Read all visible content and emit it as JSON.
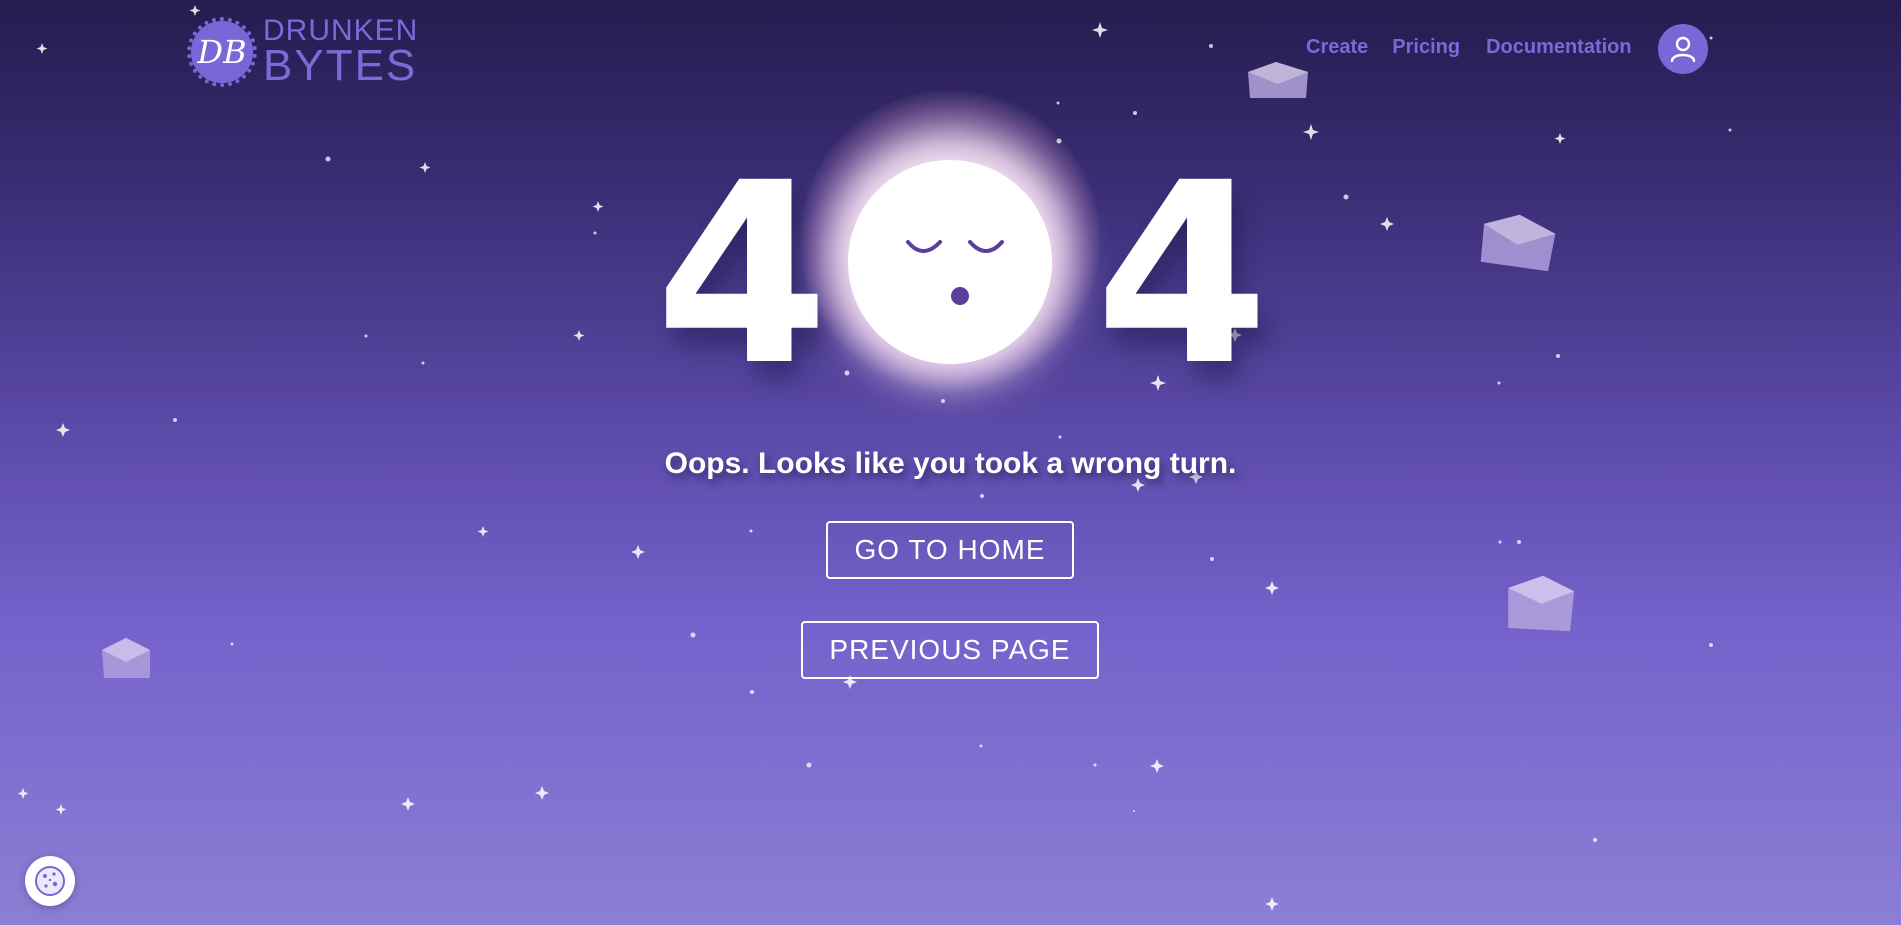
{
  "header": {
    "logo_monogram": "DB",
    "logo_line1": "DRUNKEN",
    "logo_line2": "BYTES",
    "nav": {
      "create": "Create",
      "pricing": "Pricing",
      "documentation": "Documentation"
    },
    "user_icon": "user-icon"
  },
  "error": {
    "digit_left": "4",
    "digit_right": "4",
    "moon_icon": "sleeping-moon-icon",
    "headline": "Oops. Looks like you took a wrong turn."
  },
  "buttons": {
    "home": "GO TO HOME",
    "previous": "PREVIOUS PAGE"
  },
  "cookie_icon": "cookie-icon",
  "colors": {
    "accent": "#7a66d6",
    "bg_top": "#251c4f",
    "bg_bottom": "#8c7ed4",
    "text": "#ffffff"
  }
}
